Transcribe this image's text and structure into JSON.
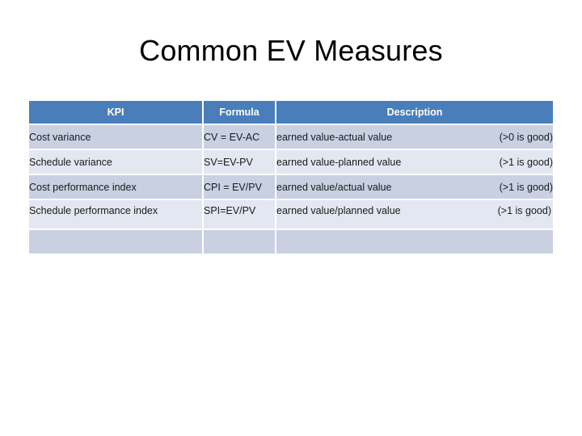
{
  "slide": {
    "title": "Common EV Measures"
  },
  "table": {
    "columns": [
      {
        "label": "KPI"
      },
      {
        "label": "Formula"
      },
      {
        "label": "Description"
      }
    ],
    "rows": [
      {
        "kpi": "Cost variance",
        "formula": "CV = EV-AC",
        "description": "earned value-actual value",
        "note": "(>0 is good)"
      },
      {
        "kpi": "Schedule variance",
        "formula": "SV=EV-PV",
        "description": "earned value-planned value",
        "note": "(>1 is good)"
      },
      {
        "kpi": "Cost performance index",
        "formula": "CPI = EV/PV",
        "description": "earned value/actual value",
        "note": "(>1 is good)"
      },
      {
        "kpi": "Schedule performance index",
        "formula": "SPI=EV/PV",
        "description": "earned value/planned value",
        "note": "(>1 is good)"
      },
      {
        "kpi": "",
        "formula": "",
        "description": "",
        "note": ""
      }
    ]
  },
  "colors": {
    "header_fill": "#4A7EBB",
    "header_text": "#FFFFFF",
    "row_dark": "#C9D0E2",
    "row_light": "#E3E7F1",
    "body_text": "#1A1A1A",
    "slide_background": "#FFFFFF"
  }
}
